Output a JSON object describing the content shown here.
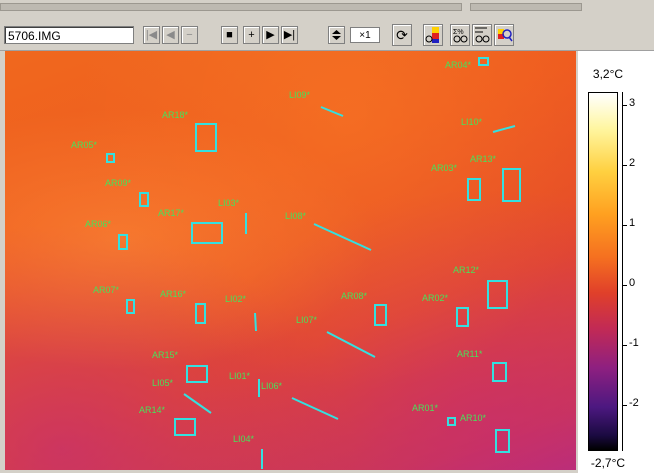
{
  "toolbar": {
    "filename": "5706.IMG",
    "step_value": "×1",
    "buttons": {
      "first": "|◀",
      "prev": "◀",
      "minus": "−",
      "stop": "■",
      "plus": "+",
      "play": "▶",
      "last": "▶|",
      "rotate": "⟳"
    }
  },
  "scale": {
    "max_label": "3,2°C",
    "min_label": "-2,7°C",
    "ticks": [
      "3",
      "2",
      "1",
      "0",
      "-1",
      "-2"
    ]
  },
  "regions": [
    {
      "id": "AR04*"
    },
    {
      "id": "LI09*"
    },
    {
      "id": "AR18*"
    },
    {
      "id": "LI10*"
    },
    {
      "id": "AR05*"
    },
    {
      "id": "AR03*"
    },
    {
      "id": "AR13*"
    },
    {
      "id": "AR09*"
    },
    {
      "id": "LI03*"
    },
    {
      "id": "AR17*"
    },
    {
      "id": "LI08*"
    },
    {
      "id": "AR06*"
    },
    {
      "id": "AR12*"
    },
    {
      "id": "AR07*"
    },
    {
      "id": "AR16*"
    },
    {
      "id": "LI02*"
    },
    {
      "id": "AR08*"
    },
    {
      "id": "AR02*"
    },
    {
      "id": "LI07*"
    },
    {
      "id": "AR15*"
    },
    {
      "id": "AR11*"
    },
    {
      "id": "LI01*"
    },
    {
      "id": "LI05*"
    },
    {
      "id": "LI06*"
    },
    {
      "id": "AR14*"
    },
    {
      "id": "AR01*"
    },
    {
      "id": "AR10*"
    },
    {
      "id": "LI04*"
    }
  ],
  "colors": {
    "marker": "#33e0e0",
    "label": "#47e25a"
  }
}
